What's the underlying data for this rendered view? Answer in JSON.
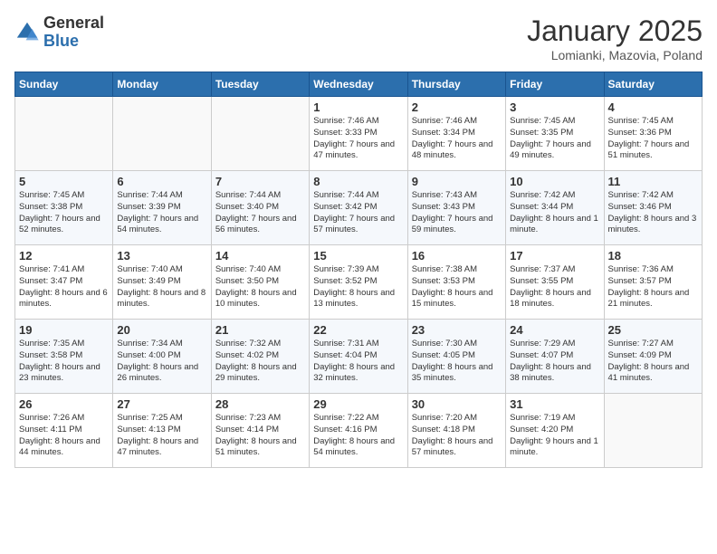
{
  "header": {
    "logo_general": "General",
    "logo_blue": "Blue",
    "month_title": "January 2025",
    "location": "Lomianki, Mazovia, Poland"
  },
  "weekdays": [
    "Sunday",
    "Monday",
    "Tuesday",
    "Wednesday",
    "Thursday",
    "Friday",
    "Saturday"
  ],
  "weeks": [
    [
      {
        "day": "",
        "info": ""
      },
      {
        "day": "",
        "info": ""
      },
      {
        "day": "",
        "info": ""
      },
      {
        "day": "1",
        "info": "Sunrise: 7:46 AM\nSunset: 3:33 PM\nDaylight: 7 hours and 47 minutes."
      },
      {
        "day": "2",
        "info": "Sunrise: 7:46 AM\nSunset: 3:34 PM\nDaylight: 7 hours and 48 minutes."
      },
      {
        "day": "3",
        "info": "Sunrise: 7:45 AM\nSunset: 3:35 PM\nDaylight: 7 hours and 49 minutes."
      },
      {
        "day": "4",
        "info": "Sunrise: 7:45 AM\nSunset: 3:36 PM\nDaylight: 7 hours and 51 minutes."
      }
    ],
    [
      {
        "day": "5",
        "info": "Sunrise: 7:45 AM\nSunset: 3:38 PM\nDaylight: 7 hours and 52 minutes."
      },
      {
        "day": "6",
        "info": "Sunrise: 7:44 AM\nSunset: 3:39 PM\nDaylight: 7 hours and 54 minutes."
      },
      {
        "day": "7",
        "info": "Sunrise: 7:44 AM\nSunset: 3:40 PM\nDaylight: 7 hours and 56 minutes."
      },
      {
        "day": "8",
        "info": "Sunrise: 7:44 AM\nSunset: 3:42 PM\nDaylight: 7 hours and 57 minutes."
      },
      {
        "day": "9",
        "info": "Sunrise: 7:43 AM\nSunset: 3:43 PM\nDaylight: 7 hours and 59 minutes."
      },
      {
        "day": "10",
        "info": "Sunrise: 7:42 AM\nSunset: 3:44 PM\nDaylight: 8 hours and 1 minute."
      },
      {
        "day": "11",
        "info": "Sunrise: 7:42 AM\nSunset: 3:46 PM\nDaylight: 8 hours and 3 minutes."
      }
    ],
    [
      {
        "day": "12",
        "info": "Sunrise: 7:41 AM\nSunset: 3:47 PM\nDaylight: 8 hours and 6 minutes."
      },
      {
        "day": "13",
        "info": "Sunrise: 7:40 AM\nSunset: 3:49 PM\nDaylight: 8 hours and 8 minutes."
      },
      {
        "day": "14",
        "info": "Sunrise: 7:40 AM\nSunset: 3:50 PM\nDaylight: 8 hours and 10 minutes."
      },
      {
        "day": "15",
        "info": "Sunrise: 7:39 AM\nSunset: 3:52 PM\nDaylight: 8 hours and 13 minutes."
      },
      {
        "day": "16",
        "info": "Sunrise: 7:38 AM\nSunset: 3:53 PM\nDaylight: 8 hours and 15 minutes."
      },
      {
        "day": "17",
        "info": "Sunrise: 7:37 AM\nSunset: 3:55 PM\nDaylight: 8 hours and 18 minutes."
      },
      {
        "day": "18",
        "info": "Sunrise: 7:36 AM\nSunset: 3:57 PM\nDaylight: 8 hours and 21 minutes."
      }
    ],
    [
      {
        "day": "19",
        "info": "Sunrise: 7:35 AM\nSunset: 3:58 PM\nDaylight: 8 hours and 23 minutes."
      },
      {
        "day": "20",
        "info": "Sunrise: 7:34 AM\nSunset: 4:00 PM\nDaylight: 8 hours and 26 minutes."
      },
      {
        "day": "21",
        "info": "Sunrise: 7:32 AM\nSunset: 4:02 PM\nDaylight: 8 hours and 29 minutes."
      },
      {
        "day": "22",
        "info": "Sunrise: 7:31 AM\nSunset: 4:04 PM\nDaylight: 8 hours and 32 minutes."
      },
      {
        "day": "23",
        "info": "Sunrise: 7:30 AM\nSunset: 4:05 PM\nDaylight: 8 hours and 35 minutes."
      },
      {
        "day": "24",
        "info": "Sunrise: 7:29 AM\nSunset: 4:07 PM\nDaylight: 8 hours and 38 minutes."
      },
      {
        "day": "25",
        "info": "Sunrise: 7:27 AM\nSunset: 4:09 PM\nDaylight: 8 hours and 41 minutes."
      }
    ],
    [
      {
        "day": "26",
        "info": "Sunrise: 7:26 AM\nSunset: 4:11 PM\nDaylight: 8 hours and 44 minutes."
      },
      {
        "day": "27",
        "info": "Sunrise: 7:25 AM\nSunset: 4:13 PM\nDaylight: 8 hours and 47 minutes."
      },
      {
        "day": "28",
        "info": "Sunrise: 7:23 AM\nSunset: 4:14 PM\nDaylight: 8 hours and 51 minutes."
      },
      {
        "day": "29",
        "info": "Sunrise: 7:22 AM\nSunset: 4:16 PM\nDaylight: 8 hours and 54 minutes."
      },
      {
        "day": "30",
        "info": "Sunrise: 7:20 AM\nSunset: 4:18 PM\nDaylight: 8 hours and 57 minutes."
      },
      {
        "day": "31",
        "info": "Sunrise: 7:19 AM\nSunset: 4:20 PM\nDaylight: 9 hours and 1 minute."
      },
      {
        "day": "",
        "info": ""
      }
    ]
  ]
}
